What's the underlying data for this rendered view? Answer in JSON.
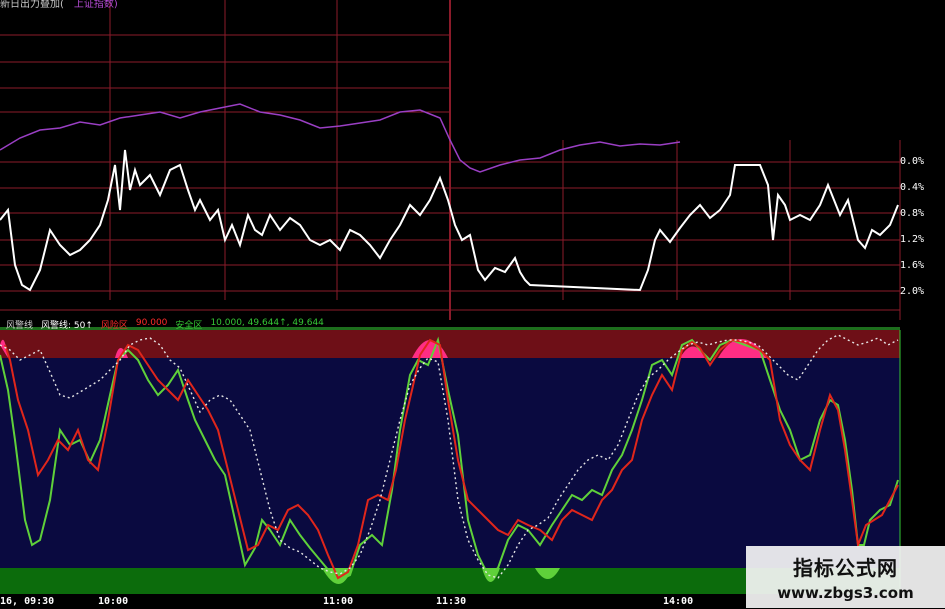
{
  "header": {
    "title": "新日出力叠加(",
    "subtitle": "上证指数)"
  },
  "upper_axis": {
    "labels": [
      "0.0%",
      "0.4%",
      "0.8%",
      "1.2%",
      "1.6%",
      "2.0%"
    ]
  },
  "lower_legend": {
    "name": "风警线",
    "item1_label": "风警线: 50↑",
    "item2_label": "风险区",
    "item2_value": "90.000",
    "item3_label": "安全区",
    "item3_value": "10.000, 49.644↑, 49.644"
  },
  "time_axis": {
    "labels": [
      "16, 09:30",
      "10:00",
      "11:00",
      "11:30",
      "14:00"
    ]
  },
  "watermark": {
    "title": "指标公式网",
    "url": "www.zbgs3.com"
  },
  "colors": {
    "grid": "#8b1b2a",
    "purple_line": "#9a3fc4",
    "white_line": "#ffffff",
    "risk_zone": "#6e0f17",
    "safe_zone": "#0c6c0c",
    "lower_bg": "#0a0a40",
    "red_line": "#e0261b",
    "green_line": "#5fd13a",
    "pink_fill": "#ff2d84"
  }
}
